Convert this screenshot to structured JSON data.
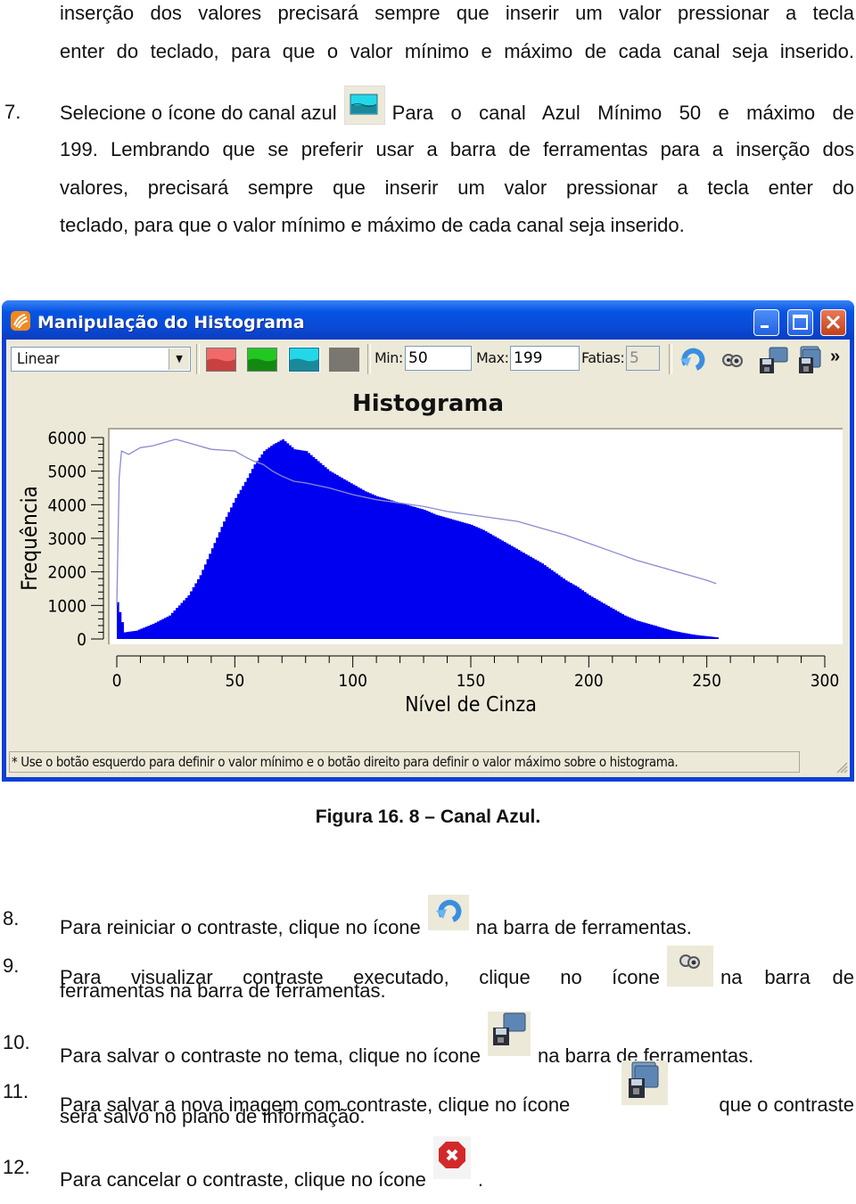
{
  "document": {
    "intro_lines": [
      "inserção dos valores precisará sempre que inserir um valor pressionar a tecla",
      "enter do teclado, para que o valor mínimo e máximo de cada canal seja inserido."
    ],
    "step7": {
      "number": "7.",
      "before_icon": "Selecione o ícone do canal azul",
      "after_icon": "Para o canal Azul Mínimo 50 e máximo de",
      "lines": [
        "199. Lembrando que se preferir usar a barra de ferramentas para a inserção dos",
        "valores, precisará sempre que inserir um valor pressionar a tecla enter do",
        "teclado, para que o valor mínimo e máximo de cada canal seja inserido."
      ],
      "icon": "blue-channel-icon"
    },
    "caption": "Figura 16. 8 – Canal Azul.",
    "steps": [
      {
        "number": "8.",
        "before_icon": "Para reiniciar o contraste, clique no ícone",
        "after_icon": "na barra de ferramentas.",
        "icon": "reset-icon"
      },
      {
        "number": "9.",
        "before_icon": "Para visualizar contraste executado, clique no ícone",
        "after_icon": "na barra de",
        "continuation": "ferramentas na barra de ferramentas.",
        "icon": "view-icon"
      },
      {
        "number": "10.",
        "before_icon": "Para salvar o contraste no tema, clique no ícone",
        "after_icon": "na barra de ferramentas.",
        "icon": "save-theme-icon"
      },
      {
        "number": "11.",
        "before_icon": "Para salvar a nova imagem com contraste, clique no ícone",
        "after_icon": "que o contraste",
        "continuation": "será salvo no plano de informação.",
        "icon": "save-image-icon"
      },
      {
        "number": "12.",
        "before_icon": "Para cancelar o contraste, clique no ícone",
        "after_icon": ".",
        "icon": "cancel-icon"
      }
    ]
  },
  "window": {
    "title": "Manipulação do Histograma",
    "app_icon": "histogram-app-icon",
    "controls": [
      "minimize",
      "maximize",
      "close"
    ],
    "toolbar": {
      "mode_select": {
        "value": "Linear"
      },
      "channels": [
        {
          "name": "red",
          "color": "#f06a6a",
          "selected": false
        },
        {
          "name": "green",
          "color": "#22c822",
          "selected": false
        },
        {
          "name": "blue",
          "color": "#22d8e8",
          "selected": true
        },
        {
          "name": "gray",
          "color": "#7a7670",
          "selected": false
        }
      ],
      "min_label": "Min:",
      "min_value": "50",
      "max_label": "Max:",
      "max_value": "199",
      "slices_label": "Fatias:",
      "slices_value": "5",
      "buttons": [
        "reset-icon",
        "view-icon",
        "save-theme-icon",
        "save-image-icon"
      ],
      "overflow": "»"
    },
    "status_text": "* Use o botão esquerdo para definir o valor mínimo e o botão direito para definir o valor máximo sobre o histograma."
  },
  "chart_data": {
    "type": "area",
    "title": "Histograma",
    "xlabel": "Nível de Cinza",
    "ylabel": "Frequência",
    "xlim": [
      0,
      300
    ],
    "ylim": [
      0,
      6000
    ],
    "xticks": [
      0,
      50,
      100,
      150,
      200,
      250,
      300
    ],
    "yticks": [
      0,
      1000,
      2000,
      3000,
      4000,
      5000,
      6000
    ],
    "fill_color": "#0000f0",
    "line_color": "#8a8ad0",
    "series": [
      {
        "name": "histogram (filled)",
        "x": [
          0,
          1,
          3,
          8,
          15,
          22,
          30,
          35,
          40,
          45,
          50,
          55,
          58,
          62,
          66,
          70,
          75,
          80,
          85,
          90,
          95,
          100,
          105,
          110,
          115,
          120,
          125,
          130,
          135,
          140,
          145,
          150,
          155,
          160,
          165,
          170,
          175,
          180,
          185,
          190,
          195,
          200,
          205,
          210,
          215,
          220,
          225,
          230,
          235,
          240,
          245,
          250,
          254
        ],
        "values": [
          1100,
          800,
          200,
          250,
          450,
          700,
          1300,
          1900,
          2700,
          3500,
          4200,
          4800,
          5200,
          5600,
          5800,
          5950,
          5650,
          5600,
          5300,
          5000,
          4800,
          4600,
          4400,
          4250,
          4150,
          4050,
          3950,
          3850,
          3700,
          3600,
          3500,
          3400,
          3250,
          3050,
          2850,
          2650,
          2450,
          2250,
          2000,
          1750,
          1550,
          1300,
          1100,
          900,
          700,
          550,
          450,
          350,
          250,
          180,
          120,
          80,
          50
        ]
      },
      {
        "name": "reference curve (line)",
        "x": [
          0,
          1,
          2,
          5,
          10,
          15,
          20,
          25,
          30,
          40,
          50,
          55,
          58,
          62,
          66,
          70,
          75,
          80,
          90,
          100,
          110,
          120,
          130,
          140,
          150,
          160,
          170,
          180,
          190,
          200,
          210,
          220,
          230,
          240,
          250,
          254
        ],
        "values": [
          1000,
          4800,
          5600,
          5500,
          5700,
          5750,
          5850,
          5950,
          5850,
          5650,
          5600,
          5400,
          5300,
          5200,
          5000,
          4850,
          4700,
          4650,
          4500,
          4300,
          4150,
          4050,
          3950,
          3800,
          3700,
          3600,
          3500,
          3300,
          3100,
          2850,
          2600,
          2350,
          2150,
          1950,
          1750,
          1650
        ]
      }
    ]
  }
}
